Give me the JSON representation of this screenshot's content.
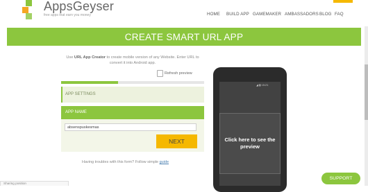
{
  "header": {
    "logo_name": "AppsGeyser",
    "logo_tagline": "free apps that earn you money",
    "nav": [
      "HOME",
      "BUILD APP",
      "GAMEMAKER",
      "AMBASSADORS",
      "BLOG",
      "FAQ"
    ]
  },
  "banner": {
    "title": "CREATE SMART URL APP"
  },
  "intro": {
    "prefix": "Use ",
    "strong": "URL App Creator",
    "rest": " to create mobile version of any Website. Enter URL to convert it into Android app."
  },
  "refresh_label": "Refresh preview",
  "progress_fraction": 0.4,
  "form": {
    "settings_label": "APP SETTINGS",
    "name_label": "APP NAME",
    "name_value": "absenspuskesmas",
    "next_label": "NEXT"
  },
  "help": {
    "text": "Having troubles with this form? Follow simple ",
    "link": "guide"
  },
  "phone": {
    "status": "◢ ▮ 15:21",
    "preview_text": "Click here to see the preview"
  },
  "support_label": "SUPPORT",
  "bottom_tab": "Sharing position",
  "colors": {
    "brand_green": "#8cc63e",
    "accent_yellow": "#f5b800",
    "logo_orange": "#f5a623",
    "logo_green": "#8cc63e"
  },
  "icons": {
    "logo": "appsgeyser-logo-icon",
    "refresh": "refresh-icon"
  }
}
